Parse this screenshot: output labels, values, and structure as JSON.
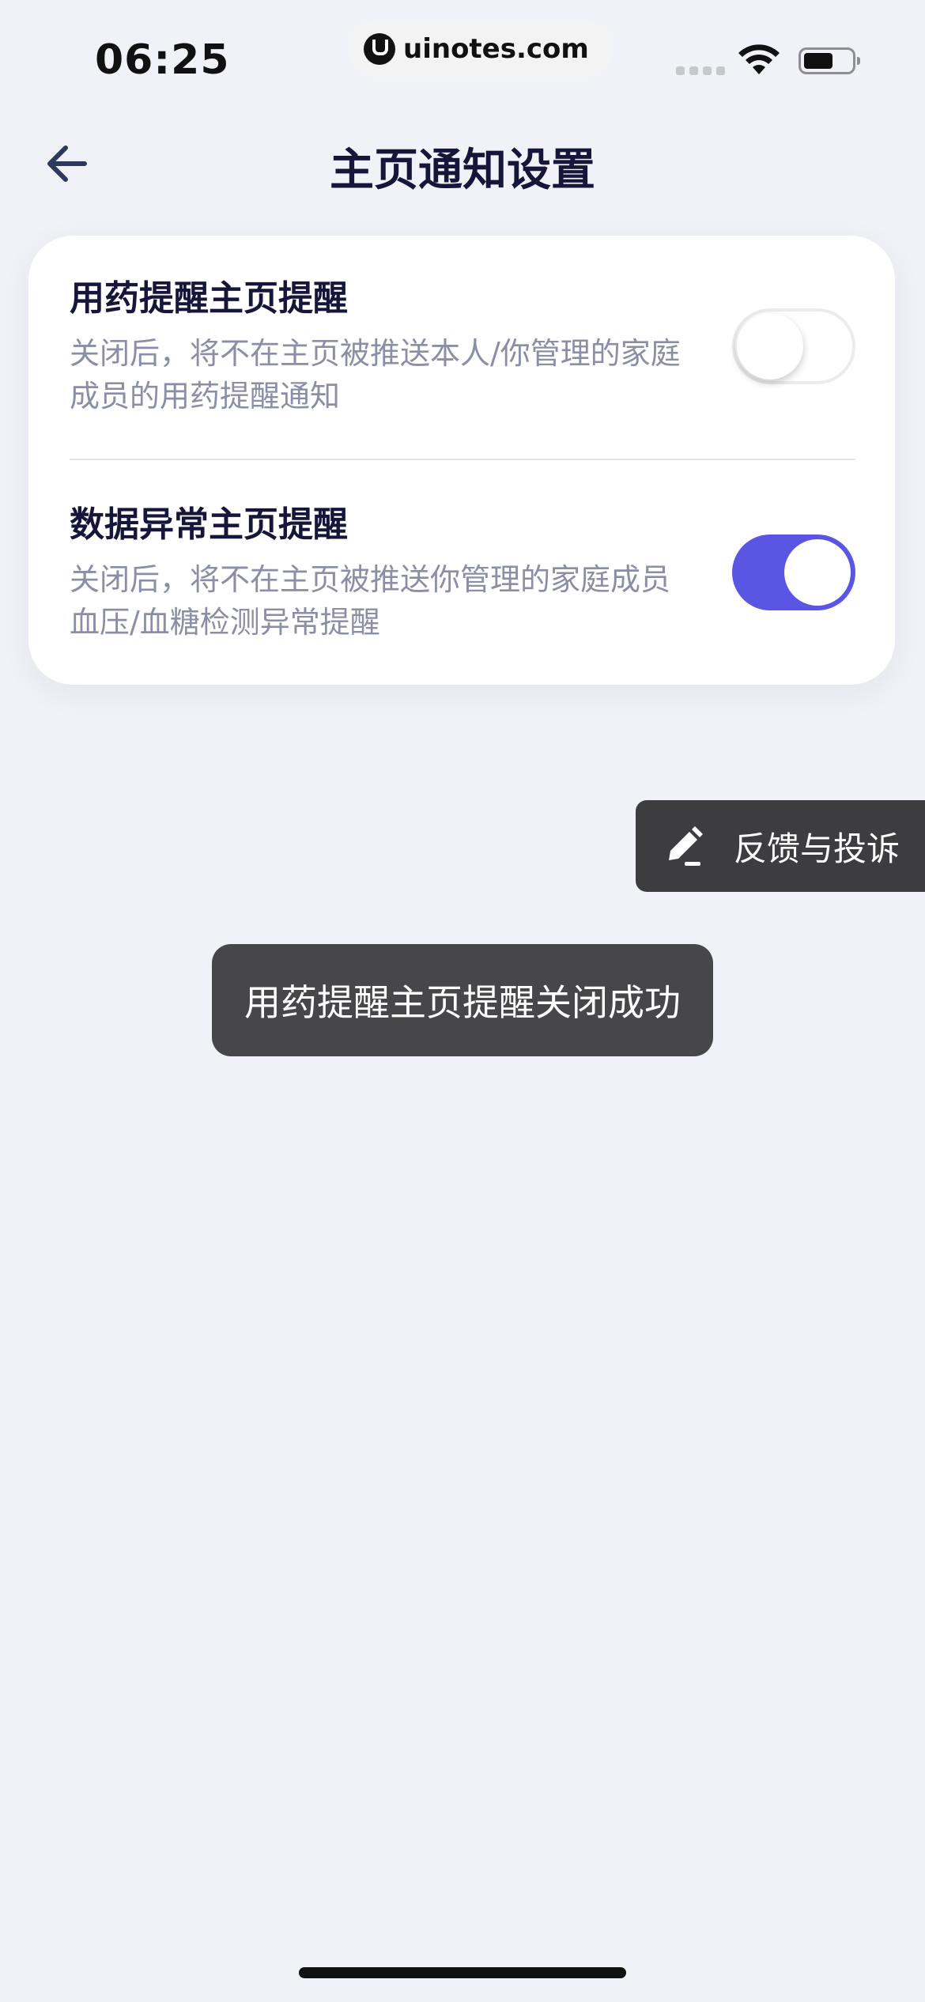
{
  "status_bar": {
    "time": "06:25",
    "watermark": "uinotes.com"
  },
  "header": {
    "title": "主页通知设置",
    "back_icon": "arrow-left-icon"
  },
  "settings": [
    {
      "title": "用药提醒主页提醒",
      "description": "关闭后，将不在主页被推送本人/你管理的家庭成员的用药提醒通知",
      "enabled": false
    },
    {
      "title": "数据异常主页提醒",
      "description": "关闭后，将不在主页被推送你管理的家庭成员血压/血糖检测异常提醒",
      "enabled": true
    }
  ],
  "feedback": {
    "label": "反馈与投诉",
    "icon": "edit-pen-icon"
  },
  "toast": {
    "message": "用药提醒主页提醒关闭成功"
  },
  "colors": {
    "accent": "#5a55e3",
    "background": "#f1f2f7",
    "title": "#16163a",
    "description": "#8a8fa6",
    "toast_bg": "#474749"
  }
}
